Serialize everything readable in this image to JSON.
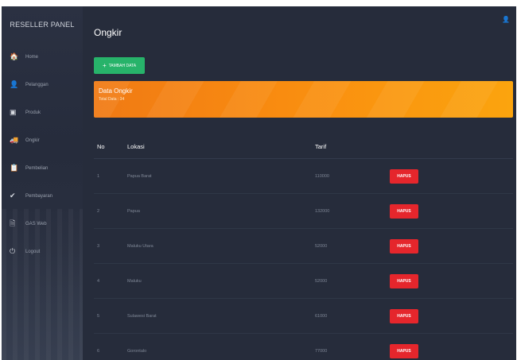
{
  "sidebar": {
    "brand": "RESELLER PANEL",
    "items": [
      {
        "icon": "home-icon",
        "glyph": "🏠",
        "label": "Home"
      },
      {
        "icon": "user-icon",
        "glyph": "👤",
        "label": "Pelanggan"
      },
      {
        "icon": "product-icon",
        "glyph": "▣",
        "label": "Produk"
      },
      {
        "icon": "truck-icon",
        "glyph": "🚚",
        "label": "Ongkir"
      },
      {
        "icon": "clipboard-icon",
        "glyph": "📋",
        "label": "Pembelian"
      },
      {
        "icon": "check-icon",
        "glyph": "✔",
        "label": "Pembayaran"
      },
      {
        "icon": "document-icon",
        "glyph": "🗎",
        "label": "GAS Web"
      },
      {
        "icon": "power-icon",
        "glyph": "⏻",
        "label": "Logout"
      }
    ]
  },
  "header": {
    "title": "Ongkir",
    "user_glyph": "👤"
  },
  "toolbar": {
    "add_label": "TAMBAH DATA",
    "add_glyph": "+"
  },
  "banner": {
    "title": "Data Ongkir",
    "subtitle": "Total Data : 34"
  },
  "table": {
    "headers": {
      "no": "No",
      "lokasi": "Lokasi",
      "tarif": "Tarif"
    },
    "delete_label": "HAPUS",
    "rows": [
      {
        "no": "1",
        "lokasi": "Papua Barat",
        "tarif": "110000"
      },
      {
        "no": "2",
        "lokasi": "Papua",
        "tarif": "132000"
      },
      {
        "no": "3",
        "lokasi": "Maluku Utara",
        "tarif": "52000"
      },
      {
        "no": "4",
        "lokasi": "Maluku",
        "tarif": "52000"
      },
      {
        "no": "5",
        "lokasi": "Sulawesi Barat",
        "tarif": "61000"
      },
      {
        "no": "6",
        "lokasi": "Gorontalo",
        "tarif": "77000"
      }
    ]
  },
  "colors": {
    "sidebar_bg": "#2a3040",
    "main_bg": "#262c3b",
    "add_button": "#27b36a",
    "banner_start": "#f07a14",
    "banner_end": "#fba40e",
    "delete_button": "#e5262c"
  }
}
